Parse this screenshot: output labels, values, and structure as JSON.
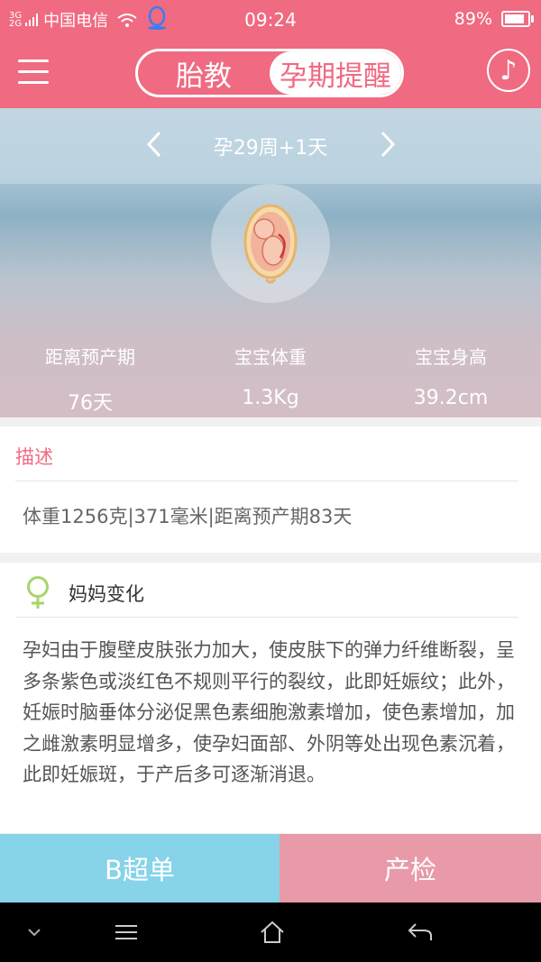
{
  "status_bar": {
    "signal_top": "3G",
    "signal_bottom": "2G",
    "carrier": "中国电信",
    "time": "09:24",
    "battery_pct": "89%",
    "battery_level": 0.89
  },
  "header": {
    "tabs": [
      {
        "label": "胎教",
        "active": false
      },
      {
        "label": "孕期提醒",
        "active": true
      }
    ],
    "music_icon": "♪"
  },
  "week": {
    "label": "孕29周+1天"
  },
  "stats": [
    {
      "label": "距离预产期",
      "value": "76天"
    },
    {
      "label": "宝宝体重",
      "value": "1.3Kg"
    },
    {
      "label": "宝宝身高",
      "value": "39.2cm"
    }
  ],
  "description": {
    "title": "描述",
    "text": "体重1256克|371毫米|距离预产期83天"
  },
  "mom_changes": {
    "title": "妈妈变化",
    "text": "孕妇由于腹壁皮肤张力加大，使皮肤下的弹力纤维断裂，呈多条紫色或淡红色不规则平行的裂纹，此即妊娠纹；此外，妊娠时脑垂体分泌促黑色素细胞激素增加，使色素增加，加之雌激素明显增多，使孕妇面部、外阴等处出现色素沉着，此即妊娠斑，于产后多可逐渐消退。"
  },
  "actions": {
    "ultrasound": "B超单",
    "checkup": "产检"
  },
  "colors": {
    "brand": "#f06a82",
    "ultrasound_button": "#87d3ea",
    "checkup_button": "#e89aa9"
  }
}
